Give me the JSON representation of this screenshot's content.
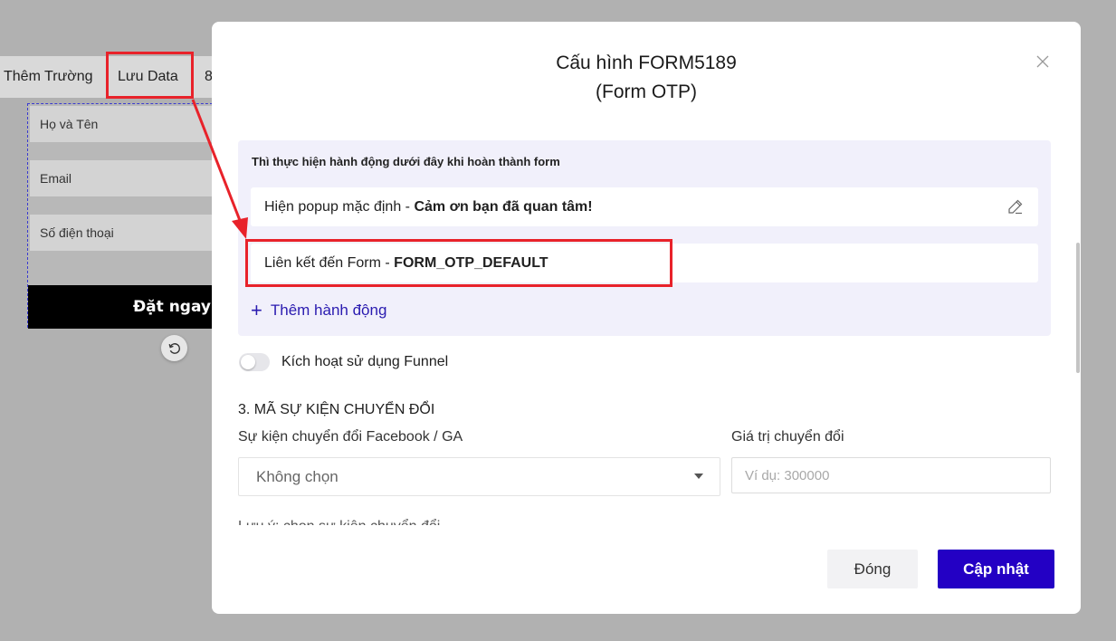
{
  "editor": {
    "toolbar": {
      "add_field": "Thêm Trường",
      "save_data": "Lưu Data",
      "more": "8"
    },
    "form_preview": {
      "fields": [
        "Họ và Tên",
        "Email",
        "Số điện thoại"
      ],
      "submit_label": "Đặt ngay"
    }
  },
  "modal": {
    "title_line1": "Cấu hình FORM5189",
    "title_line2": "(Form OTP)",
    "actions_panel": {
      "heading": "Thì thực hiện hành động dưới đây khi hoàn thành form",
      "items": [
        {
          "prefix": "Hiện popup mặc định - ",
          "value": "Cảm ơn bạn đã quan tâm!"
        },
        {
          "prefix": "Liên kết đến Form - ",
          "value": "FORM_OTP_DEFAULT"
        }
      ],
      "add_action": "Thêm hành động"
    },
    "funnel_toggle": {
      "label": "Kích hoạt sử dụng Funnel",
      "enabled": false
    },
    "conversion": {
      "section_title": "3. MÃ SỰ KIỆN CHUYỂN ĐỔI",
      "event_label": "Sự kiện chuyển đổi Facebook / GA",
      "event_value": "Không chọn",
      "value_label": "Giá trị chuyển đổi",
      "value_placeholder": "Ví dụ: 300000"
    },
    "cutoff_text": "Lưu ý: chọn sự kiện chuyển đổi",
    "buttons": {
      "close": "Đóng",
      "update": "Cập nhật"
    }
  },
  "colors": {
    "primary": "#2300c4",
    "link": "#2a1bb0",
    "highlight": "#e8222a",
    "panel_bg": "#f1f0fb"
  }
}
